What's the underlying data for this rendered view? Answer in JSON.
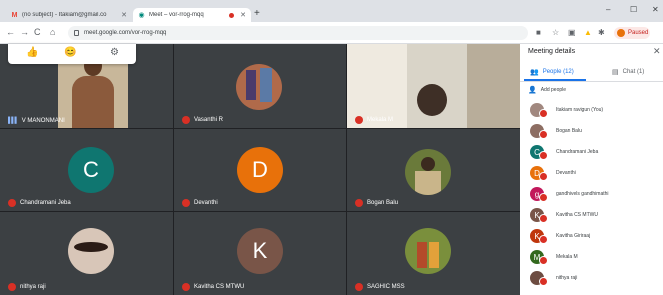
{
  "browser": {
    "tabs": [
      {
        "title": "(no subject) - Itakiam@gmail.co",
        "active": false,
        "icon": "gmail-icon"
      },
      {
        "title": "Meet – vor-rrog-mqq",
        "active": true,
        "icon": "meet-icon"
      }
    ],
    "address": "meet.google.com/vor-rrog-mqq",
    "profile_status": "Paused"
  },
  "meet": {
    "reactions": [
      "thumbs-up-icon",
      "face-emoji-icon",
      "settings-icon"
    ],
    "tiles": [
      {
        "name": "V MANONMANI",
        "type": "photo"
      },
      {
        "name": "Vasanthi R",
        "type": "avatar-photo"
      },
      {
        "name": "Mekala M",
        "type": "photo"
      },
      {
        "name": "Chandramani Jeba",
        "type": "letter",
        "letter": "C",
        "color": "#0f7670"
      },
      {
        "name": "Devanthi",
        "type": "letter",
        "letter": "D",
        "color": "#e8710a"
      },
      {
        "name": "Bogan Balu",
        "type": "avatar-photo"
      },
      {
        "name": "nithya raji",
        "type": "avatar-photo"
      },
      {
        "name": "Kavitha CS MTWU",
        "type": "letter",
        "letter": "K",
        "color": "#795548"
      },
      {
        "name": "SAGHIC MSS",
        "type": "avatar-photo"
      }
    ]
  },
  "panel": {
    "title": "Meeting details",
    "people_tab": "People (12)",
    "chat_tab": "Chat (1)",
    "add_people": "Add people",
    "participants": [
      {
        "name": "Itakiam ravigun (You)",
        "color": "#a1887f",
        "letter": ""
      },
      {
        "name": "Bogan Balu",
        "color": "#8d6e63",
        "letter": ""
      },
      {
        "name": "Chandramani Jeba",
        "color": "#0f7670",
        "letter": "C"
      },
      {
        "name": "Devanthi",
        "color": "#e8710a",
        "letter": "D"
      },
      {
        "name": "gandhivels gandhimathi",
        "color": "#c2185b",
        "letter": "g"
      },
      {
        "name": "Kavitha CS MTWU",
        "color": "#795548",
        "letter": "K"
      },
      {
        "name": "Kavitha Giriraaj",
        "color": "#bf360c",
        "letter": "K"
      },
      {
        "name": "Mekala M",
        "color": "#33691e",
        "letter": "M"
      },
      {
        "name": "nithya raji",
        "color": "#6d4c41",
        "letter": ""
      }
    ]
  }
}
